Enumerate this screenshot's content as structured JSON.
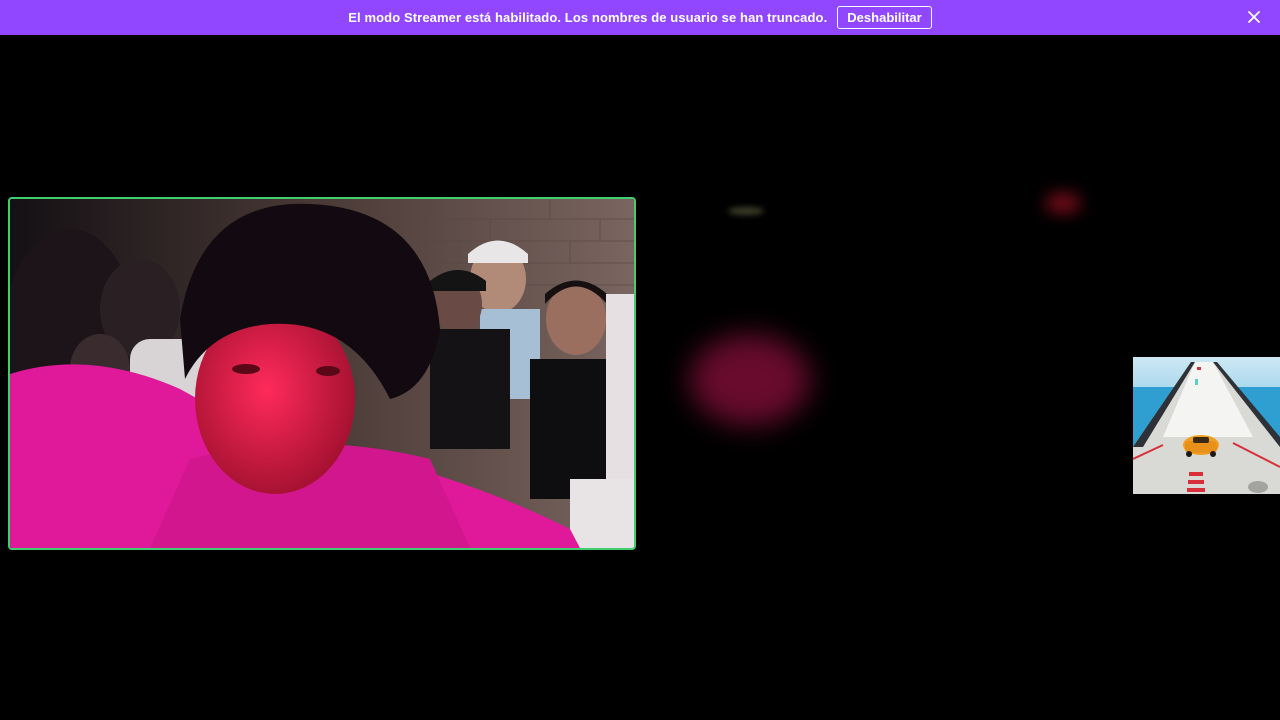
{
  "banner": {
    "message": "El modo Streamer está habilitado. Los nombres de usuario se han truncado.",
    "disable_label": "Deshabilitar",
    "background_color": "#9147ff",
    "close_icon": "close-icon"
  },
  "webcam": {
    "border_color": "#3fcf6e"
  }
}
